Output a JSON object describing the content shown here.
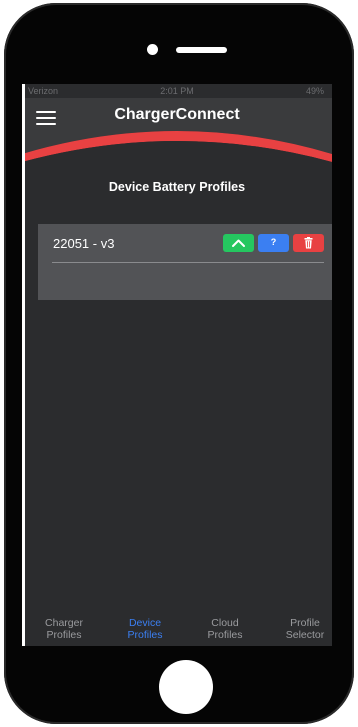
{
  "status_bar": {
    "carrier": "Verizon",
    "time": "2:01 PM",
    "battery": "49%"
  },
  "header": {
    "title": "ChargerConnect"
  },
  "page": {
    "title": "Device Battery Profiles"
  },
  "profiles": [
    {
      "name": "22051 - v3"
    }
  ],
  "profile_actions": {
    "help_label": "?"
  },
  "tabs": [
    {
      "line1": "Charger",
      "line2": "Profiles",
      "active": false
    },
    {
      "line1": "Device",
      "line2": "Profiles",
      "active": true
    },
    {
      "line1": "Cloud",
      "line2": "Profiles",
      "active": false
    },
    {
      "line1": "Profile",
      "line2": "Selector",
      "active": false
    }
  ],
  "colors": {
    "accent_red": "#e84142",
    "accent_blue": "#3b7ff2",
    "accent_green": "#25c760"
  }
}
